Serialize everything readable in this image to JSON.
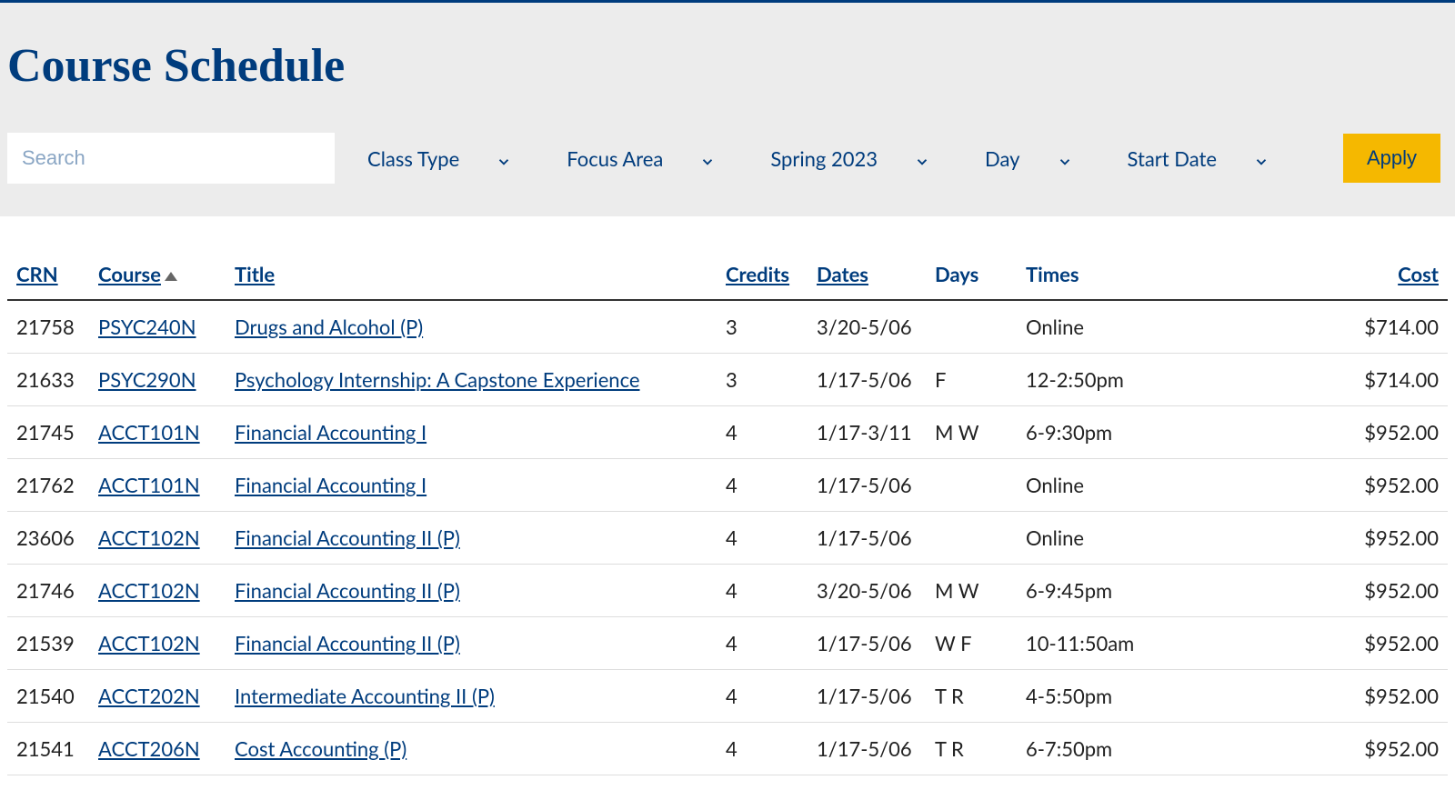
{
  "page": {
    "title": "Course Schedule"
  },
  "filters": {
    "search_placeholder": "Search",
    "class_type": "Class Type",
    "focus_area": "Focus Area",
    "term": "Spring 2023",
    "day": "Day",
    "start_date": "Start Date",
    "apply_label": "Apply"
  },
  "table": {
    "headers": {
      "crn": "CRN",
      "course": "Course",
      "title": "Title",
      "credits": "Credits",
      "dates": "Dates",
      "days": "Days",
      "times": "Times",
      "cost": "Cost"
    },
    "rows": [
      {
        "crn": "21758",
        "course": "PSYC240N",
        "title": "Drugs and Alcohol (P)",
        "credits": "3",
        "dates": "3/20-5/06",
        "days": "",
        "times": "Online",
        "cost": "$714.00"
      },
      {
        "crn": "21633",
        "course": "PSYC290N",
        "title": "Psychology Internship: A Capstone Experience",
        "credits": "3",
        "dates": "1/17-5/06",
        "days": "F",
        "times": "12-2:50pm",
        "cost": "$714.00"
      },
      {
        "crn": "21745",
        "course": "ACCT101N",
        "title": "Financial Accounting I",
        "credits": "4",
        "dates": "1/17-3/11",
        "days": "M W",
        "times": "6-9:30pm",
        "cost": "$952.00"
      },
      {
        "crn": "21762",
        "course": "ACCT101N",
        "title": "Financial Accounting I",
        "credits": "4",
        "dates": "1/17-5/06",
        "days": "",
        "times": "Online",
        "cost": "$952.00"
      },
      {
        "crn": "23606",
        "course": "ACCT102N",
        "title": "Financial Accounting II (P)",
        "credits": "4",
        "dates": "1/17-5/06",
        "days": "",
        "times": "Online",
        "cost": "$952.00"
      },
      {
        "crn": "21746",
        "course": "ACCT102N",
        "title": "Financial Accounting II (P)",
        "credits": "4",
        "dates": "3/20-5/06",
        "days": "M W",
        "times": "6-9:45pm",
        "cost": "$952.00"
      },
      {
        "crn": "21539",
        "course": "ACCT102N",
        "title": "Financial Accounting II (P)",
        "credits": "4",
        "dates": "1/17-5/06",
        "days": "W F",
        "times": "10-11:50am",
        "cost": "$952.00"
      },
      {
        "crn": "21540",
        "course": "ACCT202N",
        "title": "Intermediate Accounting II (P)",
        "credits": "4",
        "dates": "1/17-5/06",
        "days": "T R",
        "times": "4-5:50pm",
        "cost": "$952.00"
      },
      {
        "crn": "21541",
        "course": "ACCT206N",
        "title": "Cost Accounting (P)",
        "credits": "4",
        "dates": "1/17-5/06",
        "days": "T R",
        "times": "6-7:50pm",
        "cost": "$952.00"
      }
    ]
  }
}
